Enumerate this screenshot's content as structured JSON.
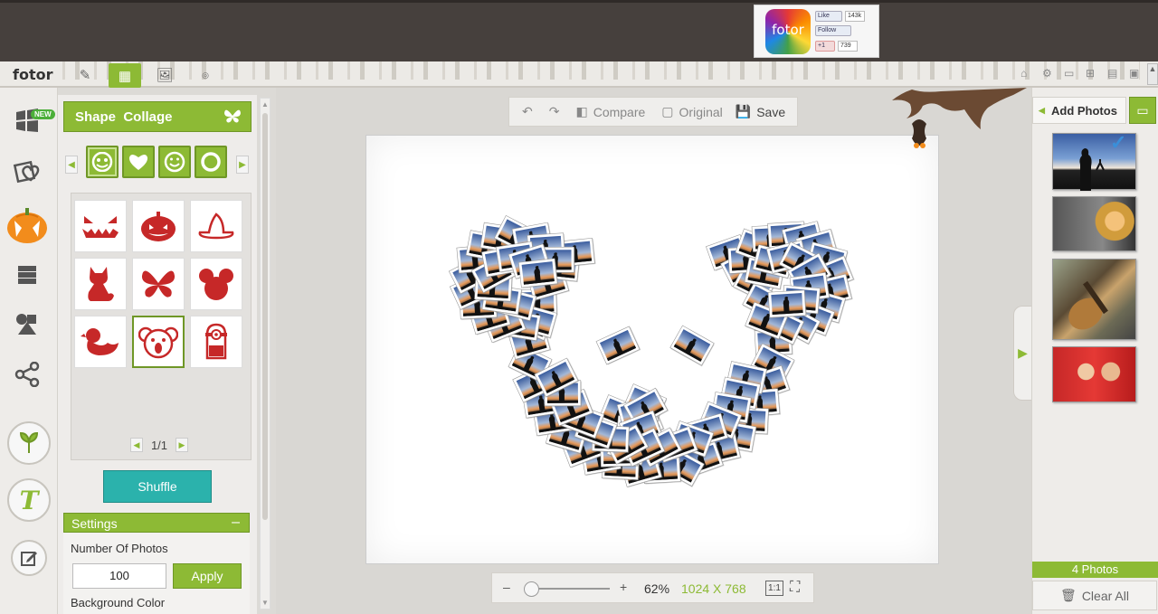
{
  "brand": "fotor",
  "ad": {
    "logo_text": "fotor",
    "like_label": "Like",
    "like_count": "143k",
    "follow_label": "Follow",
    "gplus_label": "+1",
    "gplus_count": "739"
  },
  "toolbar": {
    "items": [
      "edit-brush-icon",
      "collage-icon",
      "photo-icon",
      "hdr-icon"
    ],
    "active": "collage-icon"
  },
  "left_nav": {
    "items": [
      "classic-collage-icon",
      "artistic-collage-icon",
      "halloween-shape-icon",
      "template-collage-icon",
      "funky-collage-icon",
      "share-icon",
      "leaf-icon",
      "text-icon",
      "edit-icon"
    ],
    "new_badge": "NEW"
  },
  "panel": {
    "title": "Shape  Collage",
    "category_tabs": [
      "halloween-face-icon",
      "heart-icon",
      "smiley-icon",
      "circle-icon"
    ],
    "shapes": [
      "jack-o-lantern-face",
      "pumpkin",
      "witch-hat",
      "cat",
      "butterfly",
      "mouse",
      "duck",
      "koala",
      "minion"
    ],
    "selected_shape": "koala",
    "page": "1/1",
    "shuffle_label": "Shuffle",
    "settings_label": "Settings",
    "settings_toggle": "–",
    "num_photos_label": "Number Of Photos",
    "num_photos_value": "100",
    "apply_label": "Apply",
    "bg_color_label": "Background Color"
  },
  "canvas_controls": {
    "compare": "Compare",
    "original": "Original",
    "save": "Save"
  },
  "zoom": {
    "minus": "–",
    "plus": "+",
    "percent": "62%",
    "dimensions": "1024 X 768",
    "one_to_one": "1:1",
    "level": 0.0
  },
  "right_panel": {
    "add_photos": "Add Photos",
    "photos_count": "4 Photos",
    "clear_all": "Clear All",
    "thumbnails": [
      "silhouette-photographer",
      "hooded-person",
      "guitar",
      "couple-red"
    ]
  },
  "colors": {
    "accent": "#8dba35",
    "teal": "#2bb2ac",
    "dark_bar": "#46403d"
  }
}
